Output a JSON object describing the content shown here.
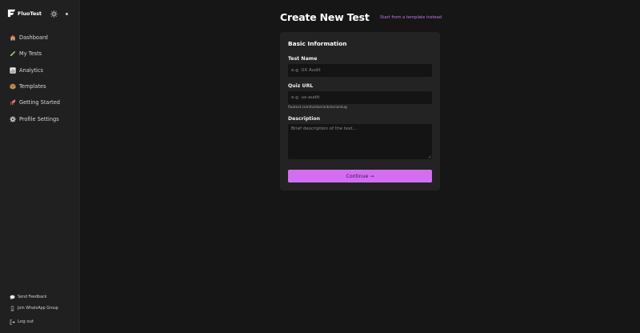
{
  "brand": {
    "name": "FluoTest"
  },
  "sidebar": {
    "items": [
      {
        "label": "Dashboard",
        "icon": "house-icon"
      },
      {
        "label": "My Tests",
        "icon": "pencil-icon"
      },
      {
        "label": "Analytics",
        "icon": "bar-chart-icon"
      },
      {
        "label": "Templates",
        "icon": "package-icon"
      },
      {
        "label": "Getting Started",
        "icon": "rocket-icon"
      },
      {
        "label": "Profile Settings",
        "icon": "gear-icon"
      }
    ],
    "bottom": {
      "feedback": "Send Feedback",
      "whatsapp": "Join WhatsApp Group",
      "logout": "Log out"
    }
  },
  "page": {
    "title": "Create New Test",
    "template_link": "Start from a template instead"
  },
  "form": {
    "section_title": "Basic Information",
    "test_name": {
      "label": "Test Name",
      "placeholder": "e.g. UX Audit",
      "value": ""
    },
    "quiz_url": {
      "label": "Quiz URL",
      "placeholder": "e.g. ux-audit",
      "value": "",
      "hint": "fluotest.com/to/dominikstoria/slug"
    },
    "description": {
      "label": "Description",
      "placeholder": "Brief description of the test...",
      "value": ""
    },
    "continue_label": "Continue →"
  },
  "colors": {
    "accent": "#d36ef3",
    "link": "#c874f0",
    "background": "#161616",
    "sidebar": "#202020",
    "card": "#232323",
    "input": "#141414"
  }
}
